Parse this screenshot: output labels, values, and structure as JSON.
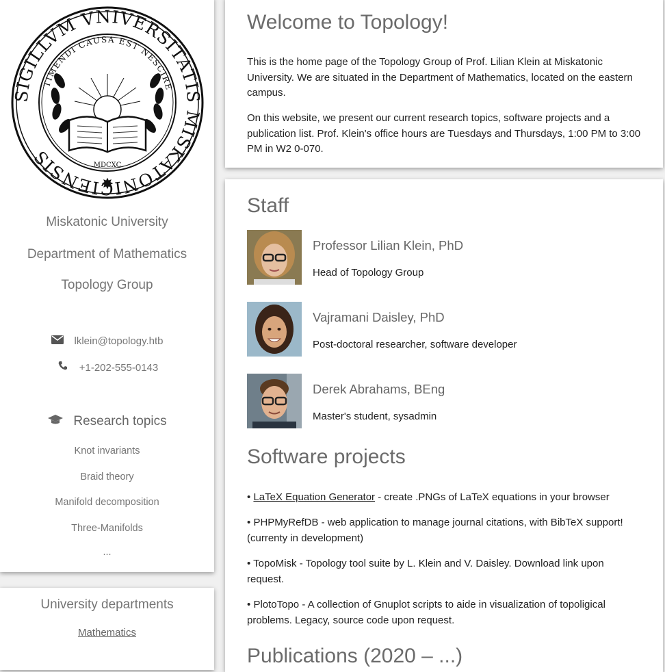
{
  "sidebar": {
    "seal": {
      "outer_text": "SIGILLVM VNIVERSITATIS MISKATONICIENSIS",
      "inner_text": "TIMENDI CAUSA EST NESCIRE",
      "year": "MDCXC"
    },
    "university": "Miskatonic University",
    "department": "Department of Mathematics",
    "group": "Topology Group",
    "email": "lklein@topology.htb",
    "phone": "+1-202-555-0143",
    "email_icon": "envelope-icon",
    "phone_icon": "phone-icon",
    "research_icon": "graduation-cap-icon",
    "research_heading": "Research topics",
    "topics": [
      "Knot invariants",
      "Braid theory",
      "Manifold decomposition",
      "Three-Manifolds",
      "..."
    ]
  },
  "departments": {
    "heading": "University departments",
    "links": [
      "Mathematics"
    ]
  },
  "welcome": {
    "title": "Welcome to Topology!",
    "p1": "This is the home page of the Topology Group of Prof. Lilian Klein at Miskatonic University. We are situated in the Department of Mathematics, located on the eastern campus.",
    "p2": "On this website, we present our current research topics, software projects and a publication list. Prof. Klein's office hours are Tuesdays and Thursdays, 1:00 PM to 3:00 PM in W2 0-070."
  },
  "staff": {
    "title": "Staff",
    "members": [
      {
        "name": "Professor Lilian Klein, PhD",
        "role": "Head of Topology Group"
      },
      {
        "name": "Vajramani Daisley, PhD",
        "role": "Post-doctoral researcher, software developer"
      },
      {
        "name": "Derek Abrahams, BEng",
        "role": "Master's student, sysadmin"
      }
    ]
  },
  "software": {
    "title": "Software projects",
    "bullet": "•",
    "items": [
      {
        "link": "LaTeX Equation Generator",
        "text": " - create .PNGs of LaTeX equations in your browser"
      },
      {
        "link": "",
        "text": "PHPMyRefDB - web application to manage journal citations, with BibTeX support! (currenty in development)"
      },
      {
        "link": "",
        "text": "TopoMisk - Topology tool suite by L. Klein and V. Daisley. Download link upon request."
      },
      {
        "link": "",
        "text": "PlotoTopo - A collection of Gnuplot scripts to aide in visualization of topoligical problems. Legacy, source code upon request."
      }
    ]
  },
  "publications": {
    "title": "Publications (2020 – ...)"
  }
}
